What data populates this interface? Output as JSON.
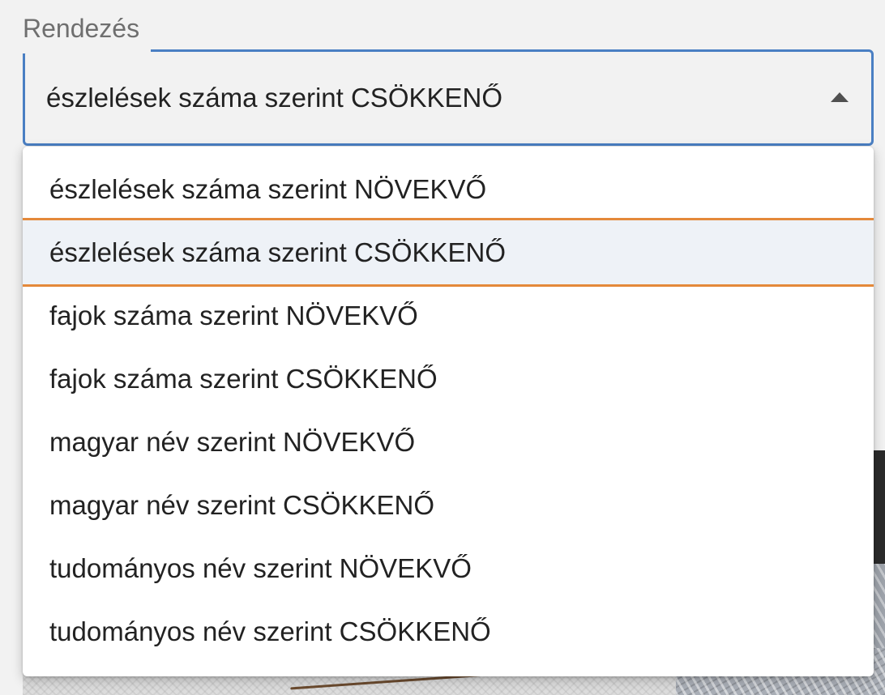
{
  "sort_field": {
    "label": "Rendezés",
    "selected_value": "észlelések száma szerint CSÖKKENŐ",
    "caret_icon": "caret-up-icon",
    "focus_color": "#4a7fc3"
  },
  "dropdown": {
    "highlight_color": "#e4893a",
    "selected_index": 1,
    "options": [
      "észlelések száma szerint NÖVEKVŐ",
      "észlelések száma szerint CSÖKKENŐ",
      "fajok száma szerint NÖVEKVŐ",
      "fajok száma szerint CSÖKKENŐ",
      "magyar név szerint NÖVEKVŐ",
      "magyar név szerint CSÖKKENŐ",
      "tudományos név szerint NÖVEKVŐ",
      "tudományos név szerint CSÖKKENŐ"
    ]
  }
}
